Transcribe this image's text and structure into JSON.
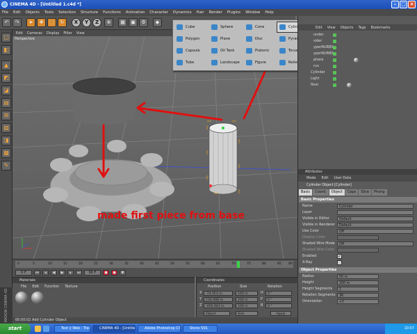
{
  "window": {
    "title": "CINEMA 4D - [Untitled 1.c4d *]"
  },
  "menu": [
    "File",
    "Edit",
    "Objects",
    "Tools",
    "Selection",
    "Structure",
    "Functions",
    "Animation",
    "Character",
    "Dynamics",
    "Hair",
    "Render",
    "Plugins",
    "Window",
    "Help"
  ],
  "toolbar": {
    "axis_x": "X",
    "axis_y": "Y",
    "axis_z": "Z"
  },
  "viewport": {
    "menu": [
      "Edit",
      "Cameras",
      "Display",
      "Filter",
      "View"
    ],
    "label": "Perspective"
  },
  "primitives_popup": {
    "items": [
      {
        "label": "Cube"
      },
      {
        "label": "Sphere"
      },
      {
        "label": "Cone"
      },
      {
        "label": "Cylinder",
        "selected": true
      },
      {
        "label": "Polygon"
      },
      {
        "label": "Plane"
      },
      {
        "label": "Disc"
      },
      {
        "label": "Pyramid"
      },
      {
        "label": "Capsule"
      },
      {
        "label": "Oil Tank"
      },
      {
        "label": "Platonic"
      },
      {
        "label": "Torus"
      },
      {
        "label": "Tube"
      },
      {
        "label": "Landscape"
      },
      {
        "label": "Figure"
      },
      {
        "label": "Relief"
      }
    ]
  },
  "object_manager": {
    "menu": [
      "Edit",
      "View",
      "Objects",
      "Tags",
      "Bookmarks"
    ],
    "rows": [
      {
        "label": "under"
      },
      {
        "label": "sider"
      },
      {
        "label": "yperNURBS"
      },
      {
        "label": "yperNURBS"
      },
      {
        "label": "phere"
      },
      {
        "label": "rus"
      },
      {
        "label": "Cylinder"
      },
      {
        "label": "Light"
      },
      {
        "label": "floor"
      }
    ]
  },
  "attributes": {
    "header": "Attributes",
    "menu": [
      "Mode",
      "Edit",
      "User Data"
    ],
    "title": "Cylinder Object [Cylinder]",
    "tabs": [
      {
        "label": "Basic",
        "on": true
      },
      {
        "label": "Coord."
      },
      {
        "label": "Object",
        "on": true
      },
      {
        "label": "Caps"
      },
      {
        "label": "Slice"
      },
      {
        "label": "Phong"
      }
    ],
    "basic_head": "Basic Properties",
    "basic": [
      {
        "label": "Name",
        "value": "Cylinder"
      },
      {
        "label": "Layer",
        "value": ""
      },
      {
        "label": "Visible in Editor",
        "value": "Default"
      },
      {
        "label": "Visible in Renderer",
        "value": "Default"
      },
      {
        "label": "Use Color",
        "value": "Off"
      },
      {
        "label": "Display Color",
        "value": ""
      },
      {
        "label": "Shaded Wire Mode",
        "value": "Off"
      },
      {
        "label": "Shaded Wire Color",
        "value": ""
      },
      {
        "label": "Enabled",
        "check": "✓"
      },
      {
        "label": "X-Ray",
        "check": ""
      }
    ],
    "object_head": "Object Properties",
    "object": [
      {
        "label": "Radius",
        "value": "50 m"
      },
      {
        "label": "Height",
        "value": "200 m"
      },
      {
        "label": "Height Segments",
        "value": "1"
      },
      {
        "label": "Rotation Segments",
        "value": "36"
      },
      {
        "label": "Orientation",
        "value": "+Y"
      }
    ]
  },
  "timeline": {
    "ticks": [
      "0",
      "5",
      "10",
      "15",
      "20",
      "25",
      "30",
      "35",
      "40",
      "45",
      "50",
      "55",
      "60",
      "65",
      "70",
      "75",
      "80",
      "85",
      "90"
    ],
    "start": "0 F",
    "end": "90 F"
  },
  "materials": {
    "header": "Materials",
    "menu": [
      "File",
      "Edit",
      "Function",
      "Texture"
    ]
  },
  "coordinates": {
    "header": "Coordinates",
    "col_position": "Position",
    "col_size": "Size",
    "col_rotation": "Rotation",
    "rows": [
      {
        "axis": "X",
        "pos": "-74.453 m",
        "size": "100 m",
        "rot_axis": "H",
        "rot": "0 °"
      },
      {
        "axis": "Y",
        "pos": "134.998 m",
        "size": "200 m",
        "rot_axis": "P",
        "rot": "0 °"
      },
      {
        "axis": "Z",
        "pos": "-450.943 m",
        "size": "100 m",
        "rot_axis": "B",
        "rot": "0 °"
      }
    ],
    "mode1": "Object",
    "mode2": "Size",
    "apply": "Apply"
  },
  "status": "00:00:02  Add Cylinder Object",
  "brand": "MAXON CINEMA 4D",
  "taskbar": {
    "start": "start",
    "buttons": [
      "Text ÿ Web - Traduc...",
      "CINEMA 4D - [Untitle...",
      "Adobe Photoshop CS...",
      "Stone SSS"
    ],
    "clock": "10:57"
  },
  "annotation": "made first piece from base",
  "colors": {
    "accent": "#d88a2c",
    "annotation": "#e01010",
    "taskbar": "#2458bf"
  }
}
